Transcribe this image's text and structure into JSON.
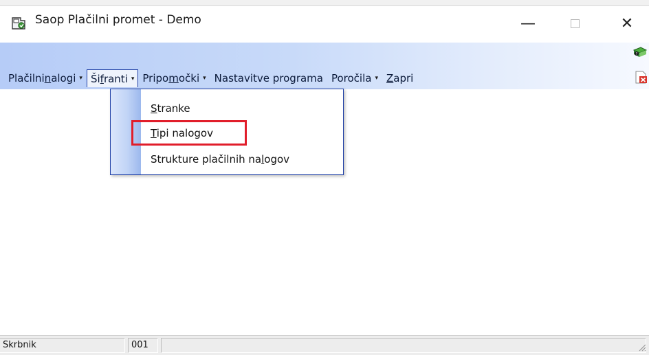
{
  "window": {
    "title": "Saop Plačilni promet - Demo",
    "app_icon": "saop-app-icon",
    "controls": {
      "minimize": "—",
      "maximize": "☐",
      "close": "✕"
    }
  },
  "ribbon": {
    "right_icons": [
      "help-book-icon",
      "close-document-icon"
    ]
  },
  "menubar": {
    "items": [
      {
        "pre": "Plačilni ",
        "key": "n",
        "post": "alogi",
        "has_arrow": true,
        "arrow": "▾"
      },
      {
        "pre": "Ši",
        "key": "f",
        "post": "ranti",
        "has_arrow": true,
        "arrow": "▾",
        "active": true
      },
      {
        "pre": "Pripo",
        "key": "m",
        "post": "očki",
        "has_arrow": true,
        "arrow": "▾"
      },
      {
        "pre": "Nastavitve programa",
        "key": "",
        "post": "",
        "has_arrow": false
      },
      {
        "pre": "Poročila",
        "key": "",
        "post": "",
        "has_arrow": true,
        "arrow": "▾"
      },
      {
        "pre": "",
        "key": "Z",
        "post": "apri",
        "has_arrow": false
      }
    ]
  },
  "dropdown": {
    "items": [
      {
        "pre": "",
        "key": "S",
        "post": "tranke"
      },
      {
        "pre": "",
        "key": "T",
        "post": "ipi nalogov",
        "highlighted": true
      },
      {
        "pre": "Strukture plačilnih na",
        "key": "l",
        "post": "ogov"
      }
    ],
    "highlight_color": "#e11d2a"
  },
  "statusbar": {
    "user": "Skrbnik",
    "code": "001",
    "message": ""
  },
  "colors": {
    "ribbon_start": "#b6ccf7",
    "menu_border": "#1e3fa6",
    "highlight": "#e11d2a"
  }
}
